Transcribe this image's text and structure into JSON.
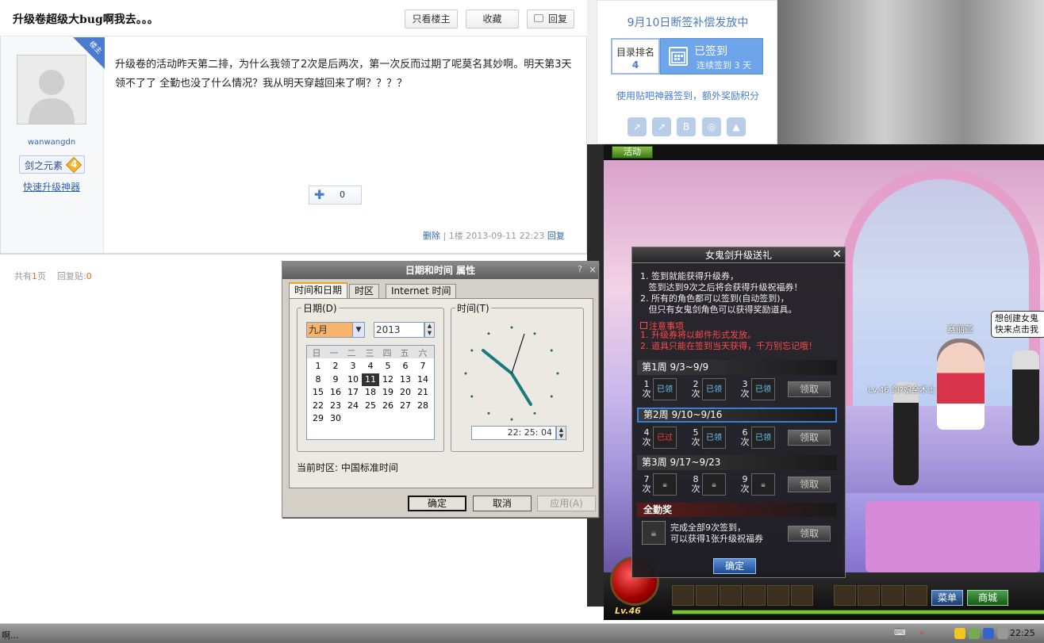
{
  "post": {
    "title": "升级卷超级大bug啊我去。。。",
    "only_author": "只看楼主",
    "favorite": "收藏",
    "reply_top": "回复",
    "corner_flag": "楼主",
    "author": "wanwangdn",
    "badge_label": "剑之元素",
    "badge_level": "4",
    "upgrade_link": "快速升级神器",
    "body": "升级卷的活动昨天第二排，为什么我领了2次是后两次，第一次反而过期了呢莫名其妙啊。明天第3天领不了了  全勤也没了什么情况？我从明天穿越回来了啊？？？？",
    "like_count": "0",
    "delete": "删除",
    "floor_meta": "| 1楼 2013-09-11 22:23",
    "reply": "回复"
  },
  "pager": {
    "total_prefix": "共有",
    "pages": "1",
    "pages_suffix": "页",
    "replies_label": "回复贴:",
    "replies": "0"
  },
  "sign": {
    "title": "9月10日断签补偿发放中",
    "rank_label": "目录排名",
    "rank_value": "4",
    "signed_label": "已签到",
    "signed_days": "连续签到 3 天",
    "hint": "使用贴吧神器签到，额外奖励积分",
    "icons": [
      "share-icon",
      "share-icon",
      "b-icon",
      "circle-icon",
      "thumb-icon"
    ]
  },
  "game": {
    "tab": "活动",
    "npc_name": "赛丽亚",
    "char_label": "Lv.46 剑?娘全术士",
    "speech": "想创建女鬼 快来点击我",
    "level": "Lv.46",
    "menu": "菜单",
    "shop": "商城",
    "event": {
      "title": "女鬼剑升级送礼",
      "rules": [
        "1. 签到就能获得升级券，",
        "   签到达到9次之后将会获得升级祝福券！",
        "2. 所有的角色都可以签到(自动签到)，",
        "   但只有女鬼剑角色可以获得奖励道具。"
      ],
      "notes_header": "注意事项",
      "notes": [
        "1. 升级券将以邮件形式发放。",
        "2. 道具只能在签到当天获得，千万别忘记哦！"
      ],
      "weeks": [
        {
          "label": "第1周  9/3~9/9",
          "slots": [
            {
              "n": "1次",
              "s": "已领取"
            },
            {
              "n": "2次",
              "s": "已领取"
            },
            {
              "n": "3次",
              "s": "已领取"
            }
          ],
          "btn": "领取"
        },
        {
          "label": "第2周  9/10~9/16",
          "slots": [
            {
              "n": "4次",
              "s": "已过期"
            },
            {
              "n": "5次",
              "s": "已领取"
            },
            {
              "n": "6次",
              "s": "已领取"
            }
          ],
          "btn": "领取"
        },
        {
          "label": "第3周  9/17~9/23",
          "slots": [
            {
              "n": "7次",
              "s": ""
            },
            {
              "n": "8次",
              "s": ""
            },
            {
              "n": "9次",
              "s": ""
            }
          ],
          "btn": "领取"
        }
      ],
      "full_header": "全勤奖",
      "full_text": "完成全部9次签到，\n可以获得1张升级祝福券",
      "full_btn": "领取",
      "ok": "确定"
    }
  },
  "datetime": {
    "title": "日期和时间 属性",
    "help": "?",
    "close": "×",
    "tabs": [
      "时间和日期",
      "时区",
      "Internet 时间"
    ],
    "date_group": "日期(D)",
    "time_group": "时间(T)",
    "month": "九月",
    "year": "2013",
    "weekdays": [
      "日",
      "一",
      "二",
      "三",
      "四",
      "五",
      "六"
    ],
    "days": [
      "1",
      "2",
      "3",
      "4",
      "5",
      "6",
      "7",
      "8",
      "9",
      "10",
      "11",
      "12",
      "13",
      "14",
      "15",
      "16",
      "17",
      "18",
      "19",
      "20",
      "21",
      "22",
      "23",
      "24",
      "25",
      "26",
      "27",
      "28",
      "29",
      "30"
    ],
    "selected_day": "11",
    "time": "22: 25: 04",
    "tz_label": "当前时区:  中国标准时间",
    "ok": "确定",
    "cancel": "取消",
    "apply": "应用(A)"
  },
  "taskbar": {
    "left_text": "啊...",
    "time": "22:25"
  }
}
